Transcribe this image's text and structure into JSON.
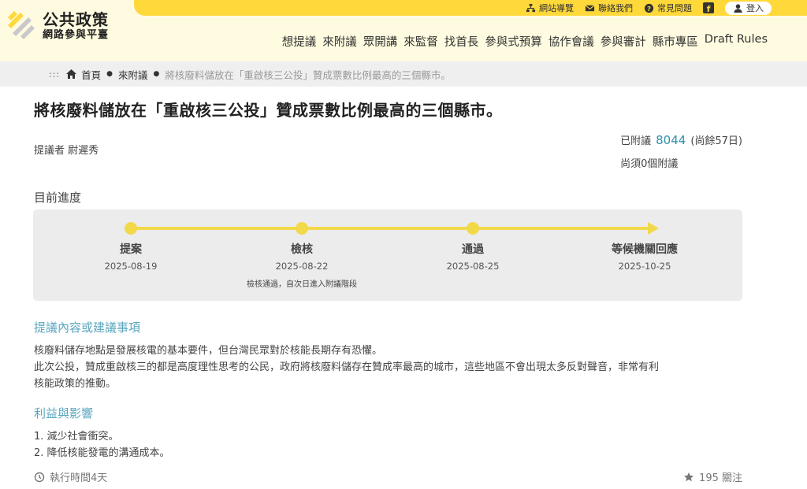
{
  "header": {
    "logo_line1": "公共政策",
    "logo_line2": "網路參與平臺",
    "top_links": [
      {
        "label": "網站導覽",
        "icon": "sitemap-icon"
      },
      {
        "label": "聯絡我們",
        "icon": "mail-icon"
      },
      {
        "label": "常見問題",
        "icon": "question-icon"
      }
    ],
    "facebook_icon": "facebook-icon",
    "login_label": "登入",
    "nav": [
      "想提議",
      "來附議",
      "眾開講",
      "來監督",
      "找首長",
      "參與式預算",
      "協作會議",
      "參與審計",
      "縣市專區",
      "Draft Rules"
    ],
    "colors": {
      "band": "#ffd83a",
      "header_bg": "#fffbe0",
      "accent": "#2f8fa6"
    }
  },
  "breadcrumb": {
    "dots": ":::",
    "home": "首頁",
    "section": "來附議",
    "current": "將核廢料儲放在「重啟核三公投」贊成票數比例最高的三個縣市。"
  },
  "proposal": {
    "title": "將核廢料儲放在「重啟核三公投」贊成票數比例最高的三個縣市。",
    "proposer": "提議者 尉遲秀",
    "signed_label": "已附議",
    "signed_count": "8044",
    "remaining_days": "(尚餘57日)",
    "needed": "尚須0個附議"
  },
  "progress": {
    "heading": "目前進度",
    "stages": [
      {
        "name": "提案",
        "date": "2025-08-19",
        "note": ""
      },
      {
        "name": "檢核",
        "date": "2025-08-22",
        "note": "檢核通過，自次日進入附議階段"
      },
      {
        "name": "通過",
        "date": "2025-08-25",
        "note": ""
      },
      {
        "name": "等候機關回應",
        "date": "2025-10-25",
        "note": ""
      }
    ]
  },
  "content": {
    "heading": "提議內容或建議事項",
    "line1": "核廢料儲存地點是發展核電的基本要件，但台灣民眾對於核能長期存有恐懼。",
    "line2": "此次公投，贊成重啟核三的都是高度理性思考的公民，政府將核廢料儲存在贊成率最高的城市，這些地區不會出現太多反對聲音，非常有利",
    "line3": "核能政策的推動。"
  },
  "benefits": {
    "heading": "利益與影響",
    "items": [
      "1. 減少社會衝突。",
      "2. 降低核能發電的溝通成本。"
    ]
  },
  "footer": {
    "duration": "執行時間4天",
    "follow": "195 關注"
  }
}
